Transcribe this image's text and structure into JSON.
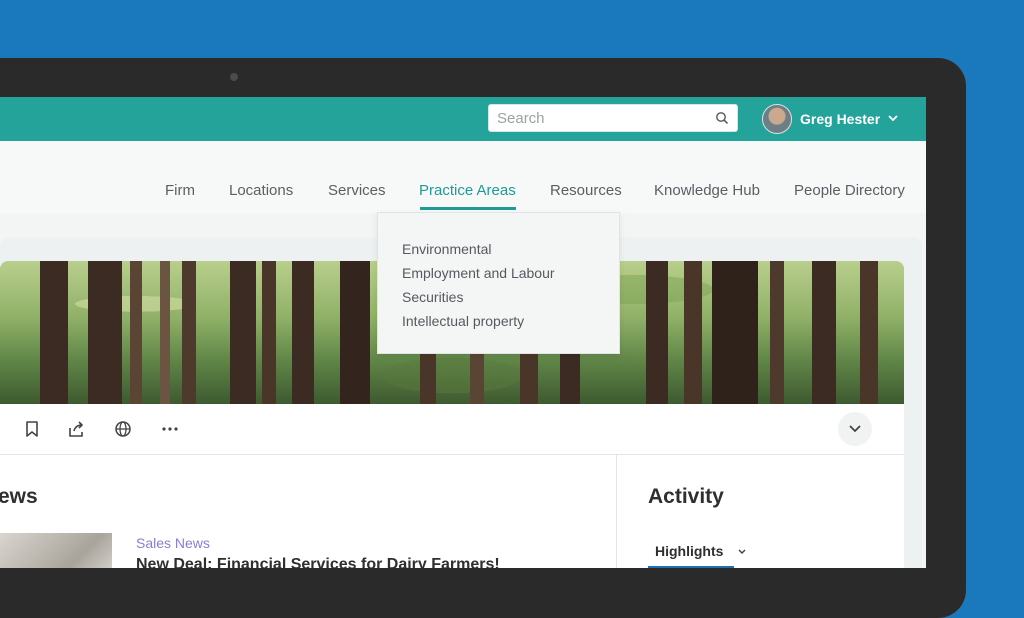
{
  "topbar": {
    "search_placeholder": "Search",
    "user_name": "Greg Hester"
  },
  "nav": {
    "items": [
      "Firm",
      "Locations",
      "Services",
      "Practice Areas",
      "Resources",
      "Knowledge Hub",
      "People Directory"
    ],
    "active": "Practice Areas"
  },
  "dropdown": {
    "items": [
      "Environmental",
      "Employment and Labour",
      "Securities",
      "Intellectual property"
    ]
  },
  "page": {
    "news_heading": "ews",
    "news_category": "Sales News",
    "news_headline": "New Deal: Financial Services for Dairy Farmers!",
    "activity_heading": "Activity",
    "activity_filter": "Highlights"
  },
  "colors": {
    "background": "#1a78bd",
    "topbar": "#24a39b",
    "accent": "#1f9b93",
    "category": "#8c7bd6"
  }
}
